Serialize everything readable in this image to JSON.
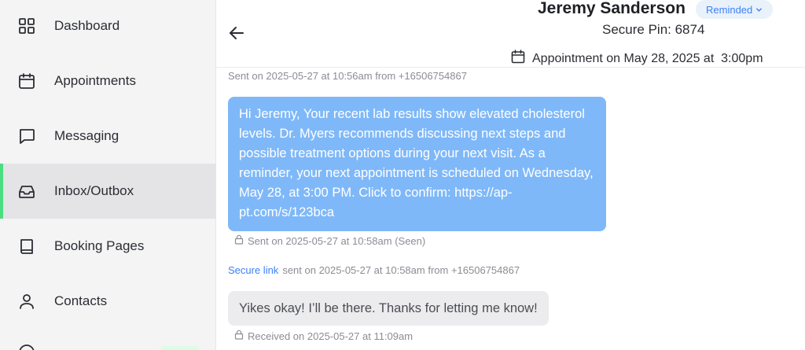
{
  "sidebar": {
    "items": [
      {
        "label": "Dashboard",
        "icon": "grid-icon"
      },
      {
        "label": "Appointments",
        "icon": "calendar-icon"
      },
      {
        "label": "Messaging",
        "icon": "chat-icon"
      },
      {
        "label": "Inbox/Outbox",
        "icon": "inbox-icon",
        "active": true
      },
      {
        "label": "Booking Pages",
        "icon": "book-icon"
      },
      {
        "label": "Contacts",
        "icon": "user-icon"
      }
    ],
    "active_color": "#4ade80"
  },
  "header": {
    "contact_name": "Jeremy Sanderson",
    "status": "Reminded",
    "secure_pin": "Secure Pin: 6874",
    "appointment": "Appointment on May 28, 2025 at  3:00pm"
  },
  "conversation": {
    "top_meta": "Sent on 2025-05-27 at 10:56am from +16506754867",
    "outgoing_message": "Hi Jeremy, Your recent lab results show elevated cholesterol levels. Dr. Myers recommends discussing next steps and possible treatment options during your next visit. As a reminder, your next appointment is scheduled on Wednesday, May 28, at 3:00 PM. Click to confirm: https://ap-pt.com/s/123bca",
    "outgoing_status": "Sent on 2025-05-27 at 10:58am (Seen)",
    "secure_link_label": "Secure link",
    "secure_link_meta": "sent on 2025-05-27 at 10:58am from +16506754867",
    "incoming_message": "Yikes okay! I’ll be there. Thanks for letting me know!",
    "incoming_status": "Received on 2025-05-27 at 11:09am"
  },
  "colors": {
    "outgoing_bubble": "#7fb8f8",
    "incoming_bubble": "#ececee",
    "link": "#3b82f6"
  }
}
